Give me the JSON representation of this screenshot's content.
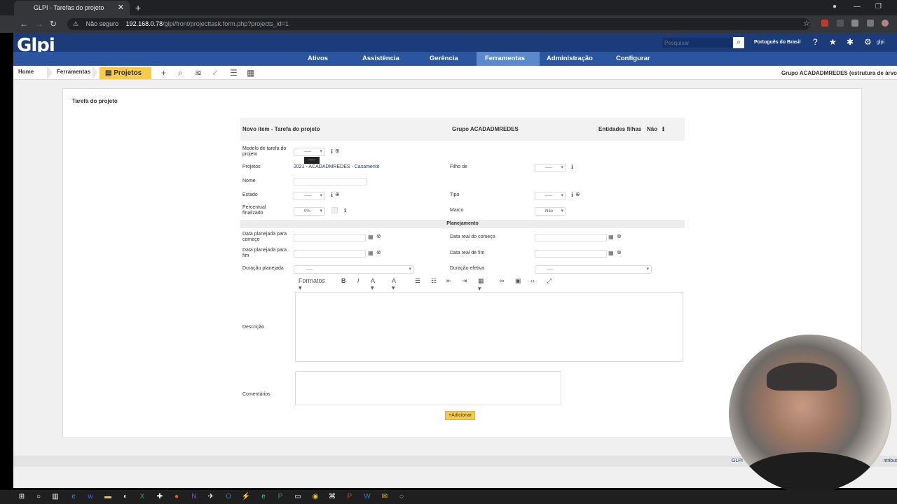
{
  "browser": {
    "tab_title": "GLPI - Tarefas do projeto",
    "url_insecure_label": "Não seguro",
    "url_host": "192.168.0.78",
    "url_path": "/glpi/front/projecttask.form.php?projects_id=1"
  },
  "header": {
    "logo": "Glpi",
    "search_placeholder": "Pesquisar",
    "language": "Português do Brasil",
    "user_label": "glpi"
  },
  "menu": {
    "items": [
      "Ativos",
      "Assistência",
      "Gerência",
      "Ferramentas",
      "Administração",
      "Configurar"
    ],
    "active": "Ferramentas"
  },
  "breadcrumb": {
    "home": "Home",
    "tools": "Ferramentas",
    "current": "Projetos",
    "entity": "Grupo ACADADMREDES (estrutura de árvo"
  },
  "panel": {
    "title": "Tarefa do projeto"
  },
  "form": {
    "header_title": "Novo item - Tarefa do projeto",
    "header_group": "Grupo ACADADMREDES",
    "child_entities_label": "Entidades filhas",
    "child_entities_value": "Não",
    "labels": {
      "template": "Modelo de tarefa do projeto",
      "projects": "Projetos",
      "child_of": "Filho de",
      "name": "Nome",
      "state": "Estado",
      "type": "Tipo",
      "percent_done": "Percentual finalizado",
      "milestone": "Marco",
      "planning_section": "Planejamento",
      "planned_start": "Data planejada para começo",
      "real_start": "Data real do começo",
      "planned_end": "Data planejada para fim",
      "real_end": "Data real de fim",
      "planned_duration": "Duração planejada",
      "effective_duration": "Duração efetiva",
      "description": "Descrição",
      "comments": "Comentários"
    },
    "values": {
      "template": "-----",
      "project_link": "2021 - ACADADMREDES - Casamento",
      "child_of": "-----",
      "state": "-----",
      "type": "-----",
      "percent_done": "0%",
      "milestone": "Não",
      "planned_duration": "-----",
      "effective_duration": "-----"
    },
    "editor_formats": "Formatos",
    "add_button": "Adicionar",
    "tooltip": "-----"
  },
  "footer": {
    "text_left": "GLPI",
    "text_right": "ntribut"
  },
  "colors": {
    "header_bg": "#1b3c79",
    "menu_bg": "#2b559e",
    "menu_active": "#5a89cc",
    "accent_yellow": "#f9cb4a"
  }
}
